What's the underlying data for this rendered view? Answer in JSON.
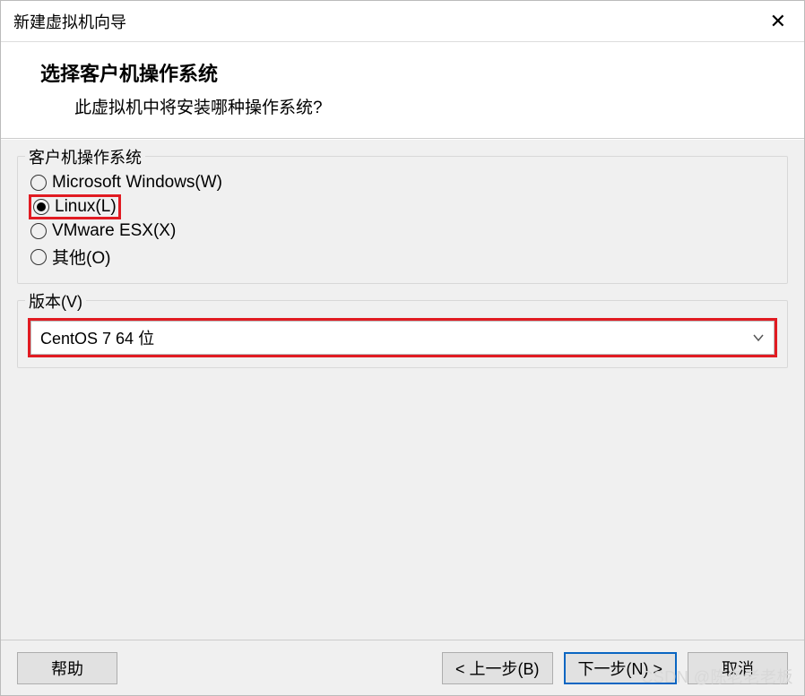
{
  "titlebar": {
    "title": "新建虚拟机向导"
  },
  "header": {
    "title": "选择客户机操作系统",
    "subtitle": "此虚拟机中将安装哪种操作系统?"
  },
  "os_group": {
    "legend": "客户机操作系统",
    "options": [
      {
        "label": "Microsoft Windows(W)",
        "selected": false
      },
      {
        "label": "Linux(L)",
        "selected": true
      },
      {
        "label": "VMware ESX(X)",
        "selected": false
      },
      {
        "label": "其他(O)",
        "selected": false
      }
    ]
  },
  "version_group": {
    "legend": "版本(V)",
    "selected": "CentOS 7 64 位"
  },
  "footer": {
    "help": "帮助",
    "back": "< 上一步(B)",
    "next": "下一步(N) >",
    "cancel": "取消"
  },
  "watermark": "CSDN @陈老老老板"
}
